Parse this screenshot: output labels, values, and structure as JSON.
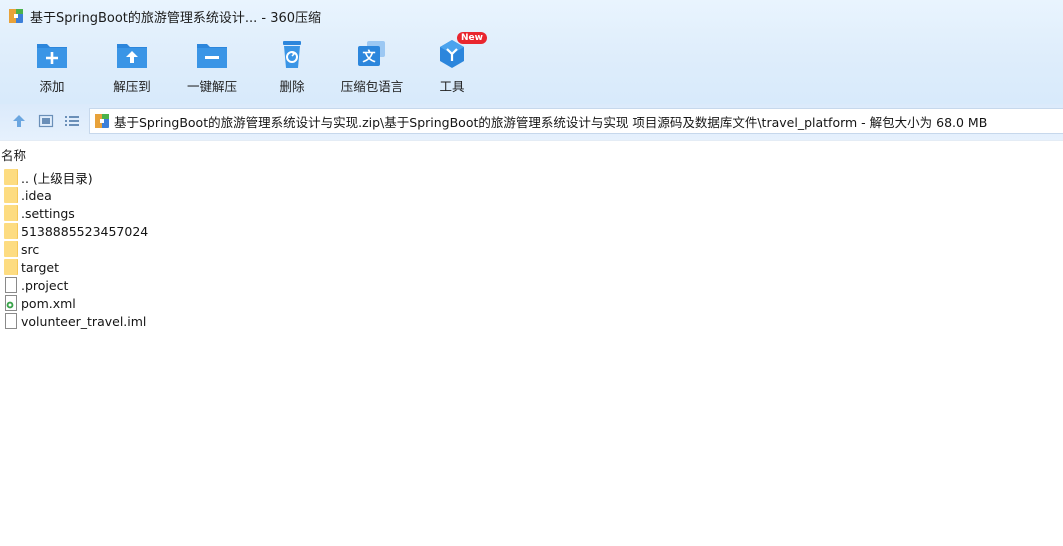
{
  "window": {
    "title": "基于SpringBoot的旅游管理系统设计... - 360压缩"
  },
  "toolbar": {
    "items": [
      {
        "label": "添加",
        "icon": "folder-add-icon"
      },
      {
        "label": "解压到",
        "icon": "folder-extract-icon"
      },
      {
        "label": "一键解压",
        "icon": "folder-oneclick-icon"
      },
      {
        "label": "删除",
        "icon": "recycle-bin-icon"
      },
      {
        "label": "压缩包语言",
        "icon": "language-icon"
      },
      {
        "label": "工具",
        "icon": "tools-icon",
        "badge": "New"
      }
    ]
  },
  "navigation": {
    "path": "基于SpringBoot的旅游管理系统设计与实现.zip\\基于SpringBoot的旅游管理系统设计与实现 项目源码及数据库文件\\travel_platform - 解包大小为 68.0 MB"
  },
  "file_list": {
    "column_name": "名称",
    "items": [
      {
        "name": ".. (上级目录)",
        "type": "folder"
      },
      {
        "name": ".idea",
        "type": "folder"
      },
      {
        "name": ".settings",
        "type": "folder"
      },
      {
        "name": "5138885523457024",
        "type": "folder"
      },
      {
        "name": "src",
        "type": "folder"
      },
      {
        "name": "target",
        "type": "folder"
      },
      {
        "name": ".project",
        "type": "file"
      },
      {
        "name": "pom.xml",
        "type": "xml"
      },
      {
        "name": "volunteer_travel.iml",
        "type": "file"
      }
    ]
  },
  "colors": {
    "accent": "#2f8fe3",
    "folder": "#fddc81",
    "badge": "#e9262f"
  }
}
